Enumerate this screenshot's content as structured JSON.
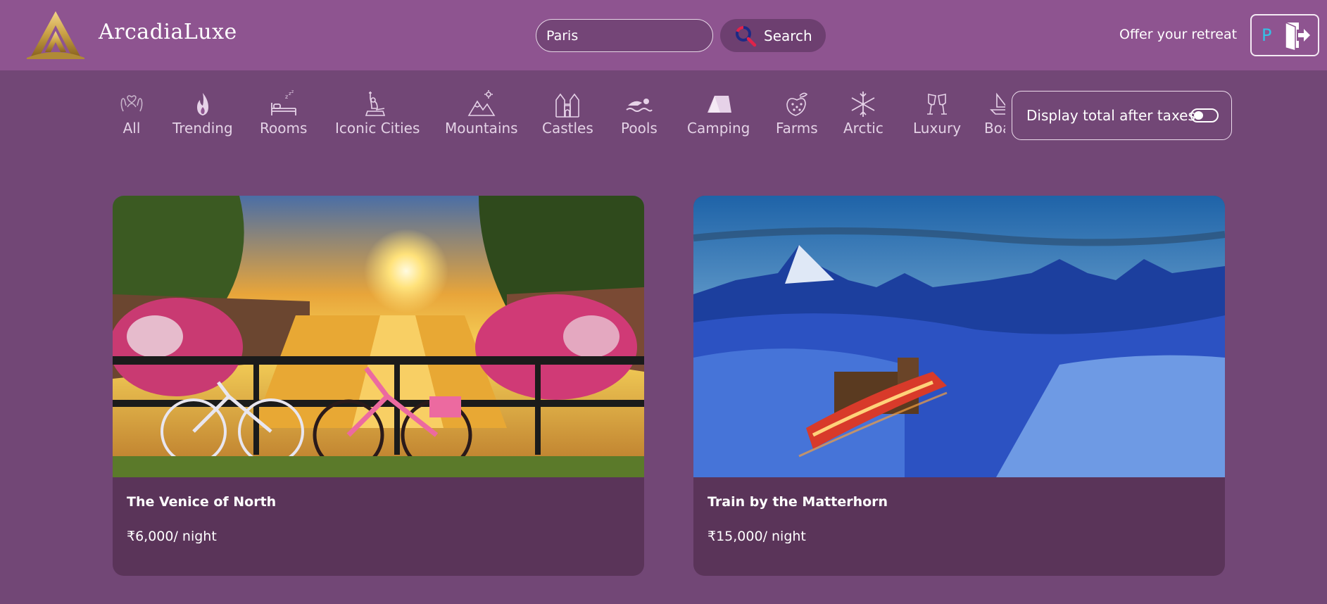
{
  "brand": {
    "name": "ArcadiaLuxe",
    "logo_icon": "golden-a-logo"
  },
  "search": {
    "value": "Paris",
    "button_label": "Search",
    "icon": "search-icon"
  },
  "header": {
    "offer_link": "Offer your retreat",
    "user_initial": "P",
    "logout_icon": "logout-icon"
  },
  "categories": [
    {
      "label": "All",
      "icon": "hands-icon"
    },
    {
      "label": "Trending",
      "icon": "flame-icon"
    },
    {
      "label": "Rooms",
      "icon": "bed-icon"
    },
    {
      "label": "Iconic Cities",
      "icon": "statue-of-liberty-icon"
    },
    {
      "label": "Mountains",
      "icon": "mountain-icon"
    },
    {
      "label": "Castles",
      "icon": "castle-icon"
    },
    {
      "label": "Pools",
      "icon": "swimmer-icon"
    },
    {
      "label": "Camping",
      "icon": "tent-icon"
    },
    {
      "label": "Farms",
      "icon": "strawberry-icon"
    },
    {
      "label": "Arctic",
      "icon": "snowflake-icon"
    },
    {
      "label": "Luxury",
      "icon": "champagne-icon"
    },
    {
      "label": "Boats",
      "icon": "boat-icon"
    }
  ],
  "filters": {
    "tax_label": "Display total after taxes",
    "tax_toggle_on": false
  },
  "listings": [
    {
      "title": "The Venice of North",
      "price": "₹6,000/ night"
    },
    {
      "title": "Train by the Matterhorn",
      "price": "₹15,000/ night"
    }
  ],
  "colors": {
    "header_bg": "#8e5490",
    "page_bg": "#724776",
    "card_bg": "#5a3459",
    "accent_gold": "#c9a045",
    "initial_blue": "#33c2e6"
  }
}
